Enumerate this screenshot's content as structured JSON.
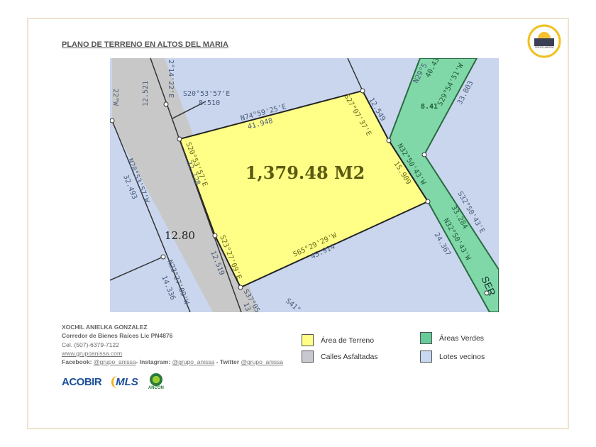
{
  "title": "PLANO DE TERRENO EN ALTOS DEL MARIA",
  "logo_text": "GRUPO ANISSA",
  "map": {
    "area": "1,379.48  M2",
    "labels": {
      "top_bearing": "N74°59'25'E",
      "top_dist": "41.948",
      "right_bearing": "S27°07'37'E",
      "right_dist": "12.549",
      "green_bearing": "N32°50'43'W",
      "green_dist": "15.909",
      "bottom_bearing": "S65°29'29'W",
      "bottom_dist": "45.914",
      "left_bearing": "S20°53'57'E",
      "left_dist": "22.728",
      "left2_bearing": "S23°27'09'E",
      "left2_dist": "12.519",
      "callout_bearing": "S20°53'57'E",
      "callout_dist": "8.510",
      "road_width": "12.80",
      "road_top_bearing": "2°14'22'E",
      "road_top_dist": "12.521",
      "road_left_bearing": "N20°53'57'W",
      "road_left_dist": "32.493",
      "road_bottom_bearing": "N23°27'09'W",
      "road_bottom_dist": "14.336",
      "green_width": "8.41",
      "green_top_bearing": "S29°54'51'W",
      "green_top_dist": "33.803",
      "green_top2": "N29°5",
      "green_top2_dist": "40.43",
      "green_right_bearing": "S32°50'43'E",
      "green_right_dist": "33.284",
      "green_left_bearing": "N32°50'43'W",
      "green_left_dist": "24.367",
      "serv": "SER",
      "bottom_cut": "S37°05'",
      "bottom_cut2": "S41°",
      "bottom_13": "13",
      "left_top": "22°W"
    }
  },
  "contact": {
    "name": "XOCHIL ANIELKA GONZALEZ",
    "role": "Corredor de Bienes Raíces Lic PN4876",
    "phone": "Cel. (507)-6379-7122",
    "web": "www.grupoanissa.com",
    "fb_label": "Facebook:",
    "fb": "@grupo_anissa",
    "ig_label": "- Instagram:",
    "ig": "@grupo_anissa",
    "tw_label": "- Twitter",
    "tw": "@grupo_anissa"
  },
  "legend": [
    {
      "label": "Área de Terreno",
      "color": "#ffff88"
    },
    {
      "label": "Calles Asfaltadas",
      "color": "#c8c8d0"
    },
    {
      "label": "Áreas Verdes",
      "color": "#66cc99"
    },
    {
      "label": "Lotes vecinos",
      "color": "#c8d8f0"
    }
  ],
  "logos": [
    "ACOBIR",
    "MLS",
    "ANCON"
  ]
}
